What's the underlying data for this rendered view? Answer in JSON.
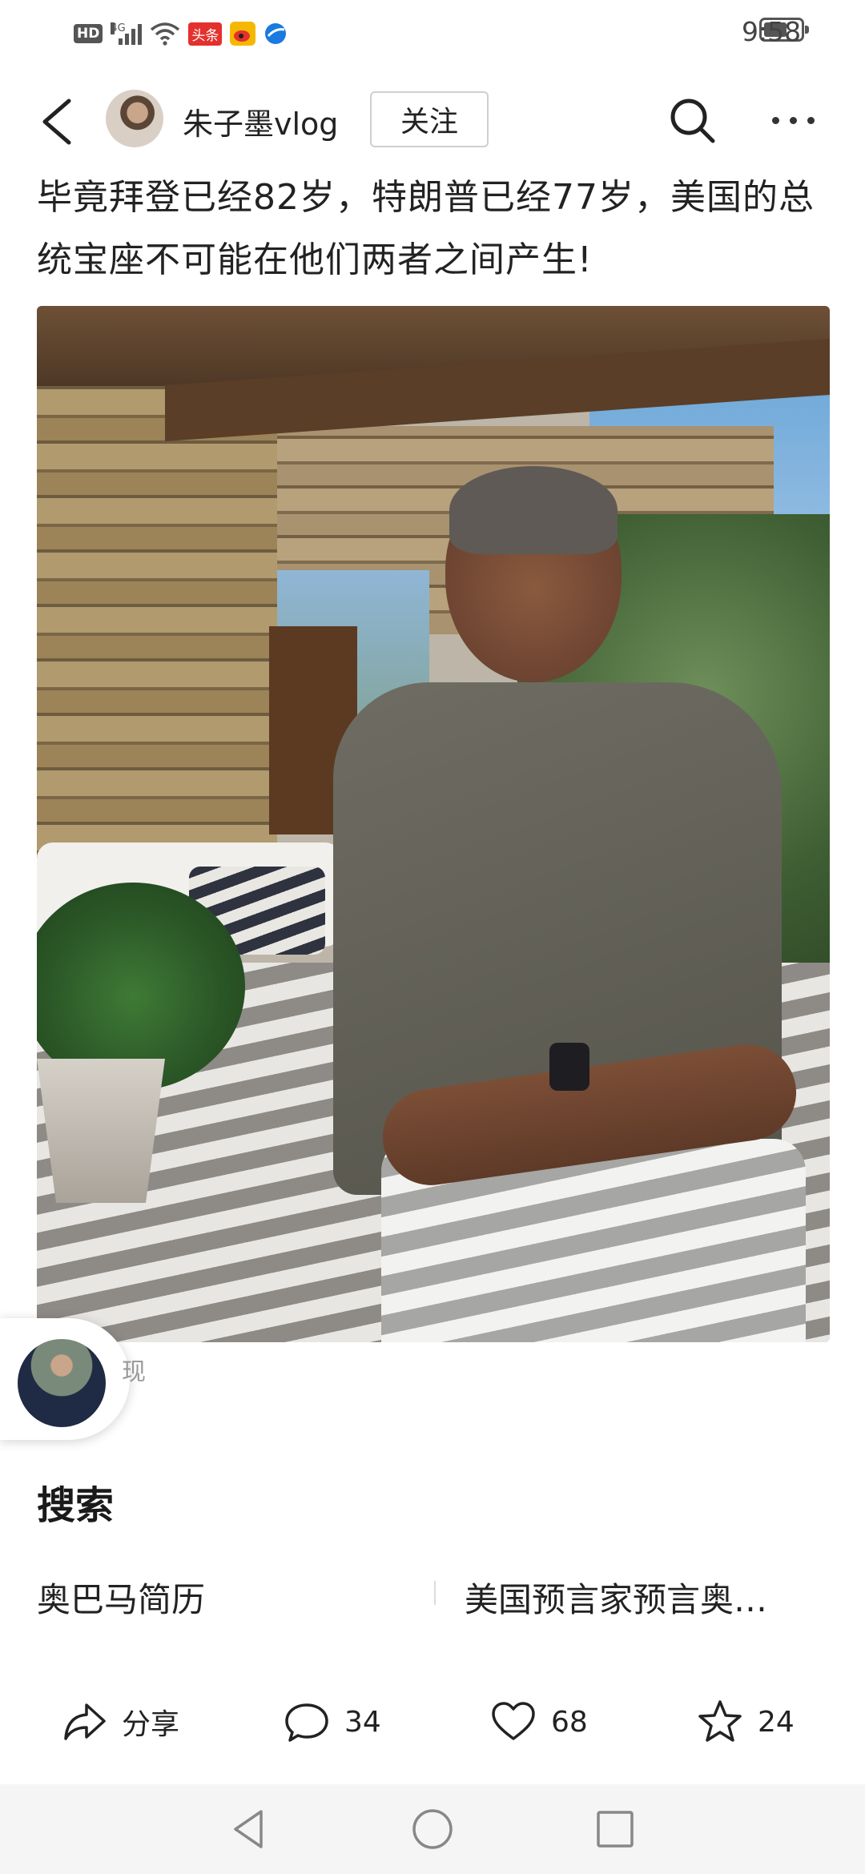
{
  "status_bar": {
    "hd": "HD",
    "network": "4G",
    "app_badge_toutiao": "头条",
    "time": "9:58",
    "battery_level": 0.55,
    "colors": {
      "toutiao_badge": "#e3312d",
      "weibo_badge": "#f5b800",
      "app_badge_blue": "#1a7ae0"
    }
  },
  "header": {
    "author_name": "朱子墨vlog",
    "follow_label": "关注",
    "icons": [
      "back-arrow-icon",
      "search-icon",
      "more-icon"
    ]
  },
  "post": {
    "title": "毕竟拜登已经82岁，特朗普已经77岁，美国的总统宝座不可能在他们两者之间产生!"
  },
  "floating": {
    "partial_text": "现"
  },
  "search_section": {
    "heading": "搜索",
    "suggestions": [
      "奥巴马简历",
      "美国预言家预言奥…"
    ]
  },
  "actions": {
    "share_label": "分享",
    "comment_count": "34",
    "like_count": "68",
    "favorite_count": "24"
  },
  "nav_bar": {
    "icons": [
      "nav-back-icon",
      "nav-home-icon",
      "nav-recents-icon"
    ]
  }
}
